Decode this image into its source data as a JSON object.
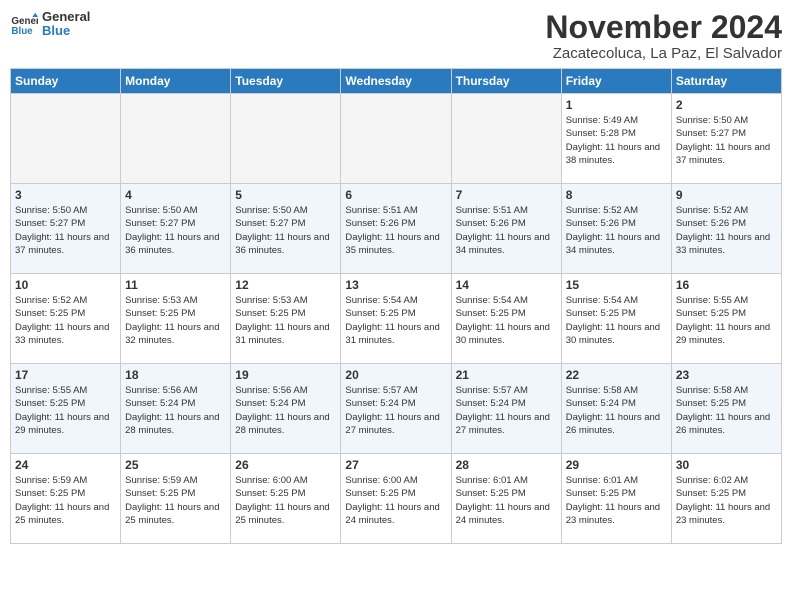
{
  "logo": {
    "line1": "General",
    "line2": "Blue"
  },
  "title": "November 2024",
  "location": "Zacatecoluca, La Paz, El Salvador",
  "weekdays": [
    "Sunday",
    "Monday",
    "Tuesday",
    "Wednesday",
    "Thursday",
    "Friday",
    "Saturday"
  ],
  "weeks": [
    [
      {
        "day": "",
        "info": ""
      },
      {
        "day": "",
        "info": ""
      },
      {
        "day": "",
        "info": ""
      },
      {
        "day": "",
        "info": ""
      },
      {
        "day": "",
        "info": ""
      },
      {
        "day": "1",
        "info": "Sunrise: 5:49 AM\nSunset: 5:28 PM\nDaylight: 11 hours and 38 minutes."
      },
      {
        "day": "2",
        "info": "Sunrise: 5:50 AM\nSunset: 5:27 PM\nDaylight: 11 hours and 37 minutes."
      }
    ],
    [
      {
        "day": "3",
        "info": "Sunrise: 5:50 AM\nSunset: 5:27 PM\nDaylight: 11 hours and 37 minutes."
      },
      {
        "day": "4",
        "info": "Sunrise: 5:50 AM\nSunset: 5:27 PM\nDaylight: 11 hours and 36 minutes."
      },
      {
        "day": "5",
        "info": "Sunrise: 5:50 AM\nSunset: 5:27 PM\nDaylight: 11 hours and 36 minutes."
      },
      {
        "day": "6",
        "info": "Sunrise: 5:51 AM\nSunset: 5:26 PM\nDaylight: 11 hours and 35 minutes."
      },
      {
        "day": "7",
        "info": "Sunrise: 5:51 AM\nSunset: 5:26 PM\nDaylight: 11 hours and 34 minutes."
      },
      {
        "day": "8",
        "info": "Sunrise: 5:52 AM\nSunset: 5:26 PM\nDaylight: 11 hours and 34 minutes."
      },
      {
        "day": "9",
        "info": "Sunrise: 5:52 AM\nSunset: 5:26 PM\nDaylight: 11 hours and 33 minutes."
      }
    ],
    [
      {
        "day": "10",
        "info": "Sunrise: 5:52 AM\nSunset: 5:25 PM\nDaylight: 11 hours and 33 minutes."
      },
      {
        "day": "11",
        "info": "Sunrise: 5:53 AM\nSunset: 5:25 PM\nDaylight: 11 hours and 32 minutes."
      },
      {
        "day": "12",
        "info": "Sunrise: 5:53 AM\nSunset: 5:25 PM\nDaylight: 11 hours and 31 minutes."
      },
      {
        "day": "13",
        "info": "Sunrise: 5:54 AM\nSunset: 5:25 PM\nDaylight: 11 hours and 31 minutes."
      },
      {
        "day": "14",
        "info": "Sunrise: 5:54 AM\nSunset: 5:25 PM\nDaylight: 11 hours and 30 minutes."
      },
      {
        "day": "15",
        "info": "Sunrise: 5:54 AM\nSunset: 5:25 PM\nDaylight: 11 hours and 30 minutes."
      },
      {
        "day": "16",
        "info": "Sunrise: 5:55 AM\nSunset: 5:25 PM\nDaylight: 11 hours and 29 minutes."
      }
    ],
    [
      {
        "day": "17",
        "info": "Sunrise: 5:55 AM\nSunset: 5:25 PM\nDaylight: 11 hours and 29 minutes."
      },
      {
        "day": "18",
        "info": "Sunrise: 5:56 AM\nSunset: 5:24 PM\nDaylight: 11 hours and 28 minutes."
      },
      {
        "day": "19",
        "info": "Sunrise: 5:56 AM\nSunset: 5:24 PM\nDaylight: 11 hours and 28 minutes."
      },
      {
        "day": "20",
        "info": "Sunrise: 5:57 AM\nSunset: 5:24 PM\nDaylight: 11 hours and 27 minutes."
      },
      {
        "day": "21",
        "info": "Sunrise: 5:57 AM\nSunset: 5:24 PM\nDaylight: 11 hours and 27 minutes."
      },
      {
        "day": "22",
        "info": "Sunrise: 5:58 AM\nSunset: 5:24 PM\nDaylight: 11 hours and 26 minutes."
      },
      {
        "day": "23",
        "info": "Sunrise: 5:58 AM\nSunset: 5:25 PM\nDaylight: 11 hours and 26 minutes."
      }
    ],
    [
      {
        "day": "24",
        "info": "Sunrise: 5:59 AM\nSunset: 5:25 PM\nDaylight: 11 hours and 25 minutes."
      },
      {
        "day": "25",
        "info": "Sunrise: 5:59 AM\nSunset: 5:25 PM\nDaylight: 11 hours and 25 minutes."
      },
      {
        "day": "26",
        "info": "Sunrise: 6:00 AM\nSunset: 5:25 PM\nDaylight: 11 hours and 25 minutes."
      },
      {
        "day": "27",
        "info": "Sunrise: 6:00 AM\nSunset: 5:25 PM\nDaylight: 11 hours and 24 minutes."
      },
      {
        "day": "28",
        "info": "Sunrise: 6:01 AM\nSunset: 5:25 PM\nDaylight: 11 hours and 24 minutes."
      },
      {
        "day": "29",
        "info": "Sunrise: 6:01 AM\nSunset: 5:25 PM\nDaylight: 11 hours and 23 minutes."
      },
      {
        "day": "30",
        "info": "Sunrise: 6:02 AM\nSunset: 5:25 PM\nDaylight: 11 hours and 23 minutes."
      }
    ]
  ]
}
